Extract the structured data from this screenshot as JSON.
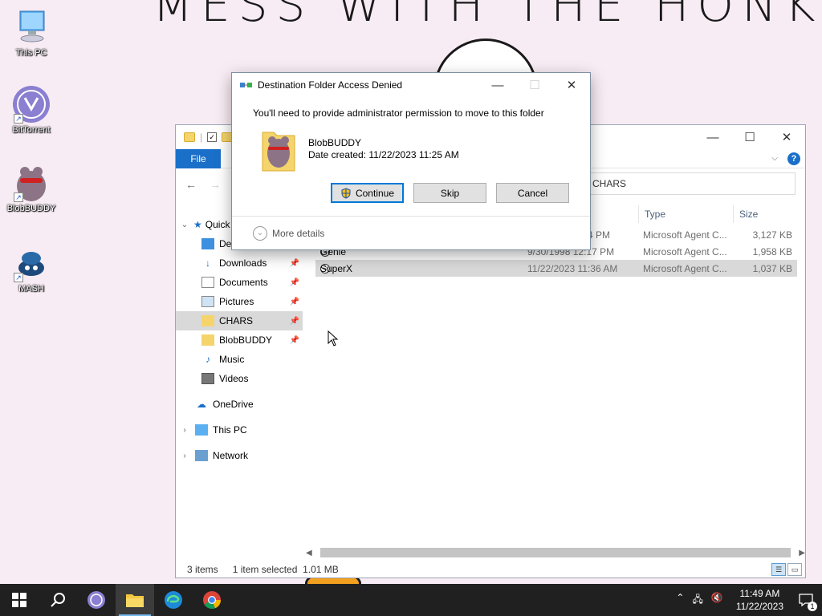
{
  "desktop": {
    "wallpaper_text": "MESS WITH THE HONK",
    "icons": [
      {
        "label": "This PC",
        "icon": "this-pc-icon"
      },
      {
        "label": "BitTorrent",
        "icon": "bittorrent-icon"
      },
      {
        "label": "BlobBUDDY",
        "icon": "blobbuddy-icon"
      },
      {
        "label": "MASH",
        "icon": "mash-icon"
      }
    ]
  },
  "explorer": {
    "ribbon": {
      "file_tab": "File"
    },
    "search_text": "CHARS",
    "columns": {
      "type": "Type",
      "size": "Size"
    },
    "nav": {
      "quick_access": "Quick access",
      "desktop": "Desktop",
      "downloads": "Downloads",
      "documents": "Documents",
      "pictures": "Pictures",
      "chars": "CHARS",
      "blobbuddy": "BlobBUDDY",
      "music": "Music",
      "videos": "Videos",
      "onedrive": "OneDrive",
      "this_pc": "This PC",
      "network": "Network"
    },
    "files": [
      {
        "name": "",
        "date": "4 PM",
        "type": "Microsoft Agent C...",
        "size": "3,127 KB"
      },
      {
        "name": "Genie",
        "date": "9/30/1998 12:17 PM",
        "type": "Microsoft Agent C...",
        "size": "1,958 KB"
      },
      {
        "name": "SuperX",
        "date": "11/22/2023 11:36 AM",
        "type": "Microsoft Agent C...",
        "size": "1,037 KB"
      }
    ],
    "status": {
      "items": "3 items",
      "selected": "1 item selected",
      "selected_size": "1.01 MB"
    }
  },
  "dialog": {
    "title": "Destination Folder Access Denied",
    "message": "You'll need to provide administrator permission to move to this folder",
    "file_name": "BlobBUDDY",
    "date_created": "Date created: 11/22/2023 11:25 AM",
    "buttons": {
      "continue": "Continue",
      "skip": "Skip",
      "cancel": "Cancel"
    },
    "more_details": "More details"
  },
  "taskbar": {
    "time": "11:49 AM",
    "date": "11/22/2023",
    "notification_count": "1"
  },
  "colors": {
    "accent": "#1a6fc8",
    "taskbar": "#202020",
    "selection": "#d9d9d9"
  }
}
